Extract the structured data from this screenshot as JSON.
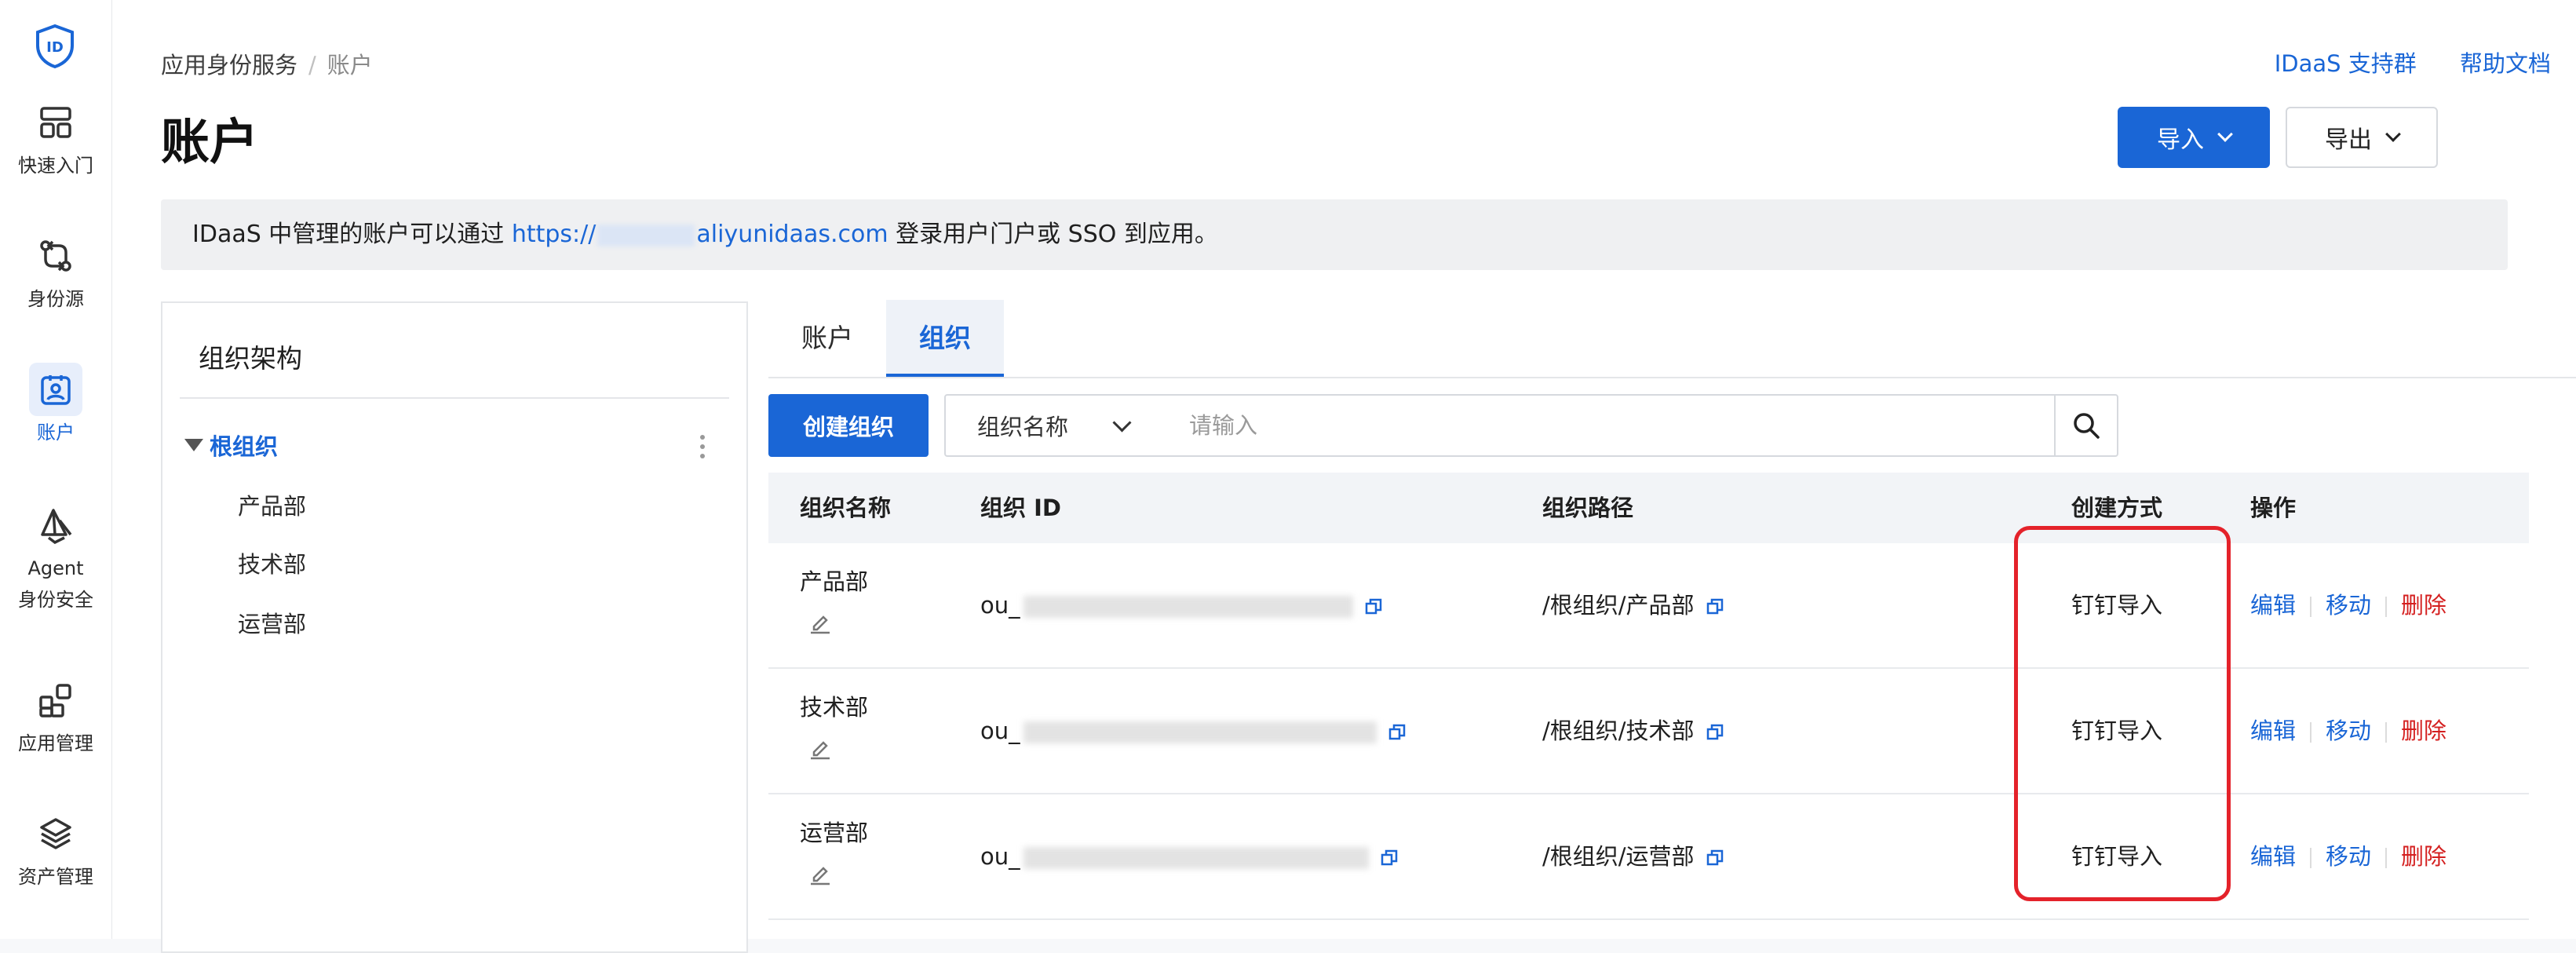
{
  "nav": {
    "items": [
      {
        "label": "快速入门",
        "icon": "grid-icon"
      },
      {
        "label": "身份源",
        "icon": "git-compare-icon"
      },
      {
        "label": "账户",
        "icon": "user-badge-icon"
      },
      {
        "label_line1": "Agent",
        "label_line2": "身份安全",
        "icon": "sail-icon"
      },
      {
        "label": "应用管理",
        "icon": "apps-icon"
      },
      {
        "label": "资产管理",
        "icon": "layers-icon"
      }
    ]
  },
  "header": {
    "breadcrumb": [
      "应用身份服务",
      "账户"
    ],
    "title": "账户",
    "links": [
      "IDaaS 支持群",
      "帮助文档"
    ],
    "import_label": "导入",
    "export_label": "导出"
  },
  "notice": {
    "prefix": "IDaaS 中管理的账户可以通过 ",
    "link_start": "https://",
    "link_end": "aliyunidaas.com",
    "suffix": " 登录用户门户或 SSO 到应用。"
  },
  "org_panel": {
    "title": "组织架构",
    "root": "根组织",
    "children": [
      "产品部",
      "技术部",
      "运营部"
    ]
  },
  "tabs": [
    "账户",
    "组织"
  ],
  "toolbar": {
    "create_label": "创建组织",
    "filter_value": "组织名称",
    "search_placeholder": "请输入"
  },
  "table": {
    "columns": [
      "组织名称",
      "组织 ID",
      "组织路径",
      "创建方式",
      "操作"
    ],
    "rows": [
      {
        "name": "产品部",
        "id_prefix": "ou_",
        "path": "/根组织/产品部",
        "method": "钉钉导入"
      },
      {
        "name": "技术部",
        "id_prefix": "ou_",
        "path": "/根组织/技术部",
        "method": "钉钉导入"
      },
      {
        "name": "运营部",
        "id_prefix": "ou_",
        "path": "/根组织/运营部",
        "method": "钉钉导入"
      }
    ],
    "actions": {
      "edit": "编辑",
      "move": "移动",
      "delete": "删除"
    }
  },
  "colors": {
    "accent": "#1a66d6",
    "danger": "#d42020",
    "highlight": "#e4222a"
  }
}
